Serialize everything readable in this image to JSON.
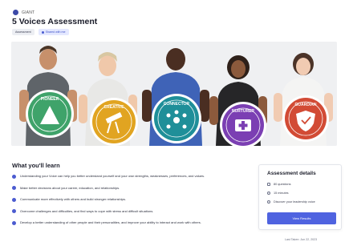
{
  "brand": {
    "name": "GIANT",
    "icon": "giant-logo-icon"
  },
  "title": "5 Voices Assessment",
  "tags": {
    "category": "Assessment",
    "shared": "Shared with me"
  },
  "hero": {
    "badges": [
      {
        "label": "PIONEER",
        "color": "#3fa36a"
      },
      {
        "label": "CREATIVE",
        "color": "#e1a421"
      },
      {
        "label": "CONNECTOR",
        "color": "#1f8f99"
      },
      {
        "label": "NURTURER",
        "color": "#7b3fb3"
      },
      {
        "label": "GUARDIAN",
        "color": "#d24b35"
      }
    ]
  },
  "learn": {
    "heading": "What you'll learn",
    "items": [
      "Understanding your Voice can help you better understand yourself and your own strengths, weaknesses, preferences, and values.",
      "Make better decisions about your career, education, and relationships.",
      "Communicate more effectively with others and build stronger relationships.",
      "Overcome challenges and difficulties, and find ways to cope with stress and difficult situations.",
      "Develop a better understanding of other people and their personalities, and improve your ability to interact and work with others."
    ]
  },
  "details": {
    "title": "Assessment details",
    "questions": "80 questions",
    "duration": "15 minutes",
    "discover": "Discover your leadership voice",
    "button": "View Results",
    "last_taken": "Last Taken: Jun 22, 2023"
  }
}
